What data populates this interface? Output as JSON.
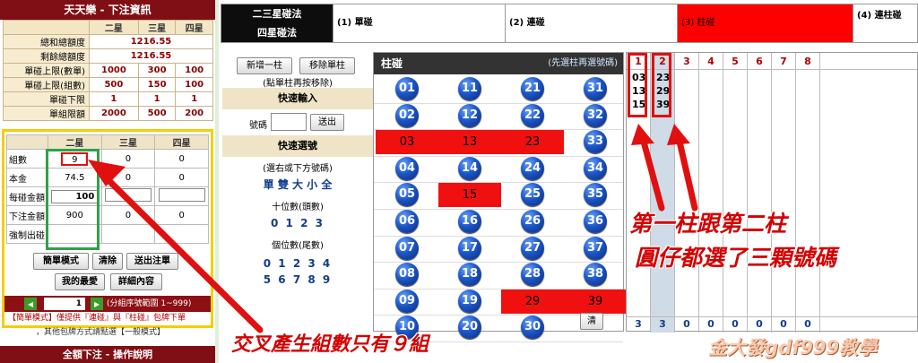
{
  "info": {
    "title": "天天樂 - 下注資訊",
    "cols": [
      "二星",
      "三星",
      "四星"
    ],
    "rows": [
      {
        "label": "總和總額度",
        "values": [
          "",
          "1216.55",
          ""
        ],
        "span": true
      },
      {
        "label": "剩餘總額度",
        "values": [
          "",
          "1216.55",
          ""
        ],
        "span": true
      },
      {
        "label": "單碰上限(數單)",
        "values": [
          "1000",
          "300",
          "100"
        ]
      },
      {
        "label": "單碰上限(組數)",
        "values": [
          "500",
          "150",
          "100"
        ]
      },
      {
        "label": "單碰下限",
        "values": [
          "1",
          "1",
          "1"
        ]
      },
      {
        "label": "單組限額",
        "values": [
          "2000",
          "500",
          "200"
        ]
      }
    ]
  },
  "bet": {
    "cols": [
      "二星",
      "三星",
      "四星"
    ],
    "rows": [
      {
        "label": "組數",
        "values": [
          "9",
          "0",
          "0"
        ]
      },
      {
        "label": "本金",
        "values": [
          "74.5",
          "0",
          "0"
        ]
      },
      {
        "label": "每碰金額",
        "values": [
          "100",
          "",
          ""
        ]
      },
      {
        "label": "下注金額",
        "values": [
          "900",
          "0",
          "0"
        ]
      },
      {
        "label": "強制出碰",
        "values": [
          "",
          "",
          ""
        ]
      }
    ],
    "buttons": {
      "simple": "簡單模式",
      "clear": "清除",
      "submit": "送出注單",
      "favorite": "我的最愛",
      "detail": "詳細內容"
    },
    "page": "1",
    "page_hint": "(分組序號範圍 1~999)",
    "note1": "【簡單模式】僅提供『連碰』與『柱碰』包牌下單",
    "note2": "，其他包牌方式請點選【一般模式】"
  },
  "bottom_left": "全額下注 - 操作說明",
  "tabs": {
    "label1": "二三星碰法",
    "label2": "四星碰法",
    "items": [
      "(1) 單碰",
      "(2) 連碰",
      "(3) 柱碰",
      "(4) 連柱碰"
    ],
    "active_color": "#ff0000"
  },
  "controls": {
    "add_col": "新增一柱",
    "remove_single": "移除單柱",
    "hint": "(點單柱再按移除)",
    "quick_input": "快速輸入",
    "number_label": "號碼",
    "send": "送出",
    "quick_select": "快速選號",
    "select_hint": "(選右或下方號碼)",
    "oddeven": "單 雙 大 小 全",
    "tens_label": "十位數(頭數)",
    "tens": "0 1 2 3",
    "units_label": "個位數(尾數)",
    "units_row1": "0 1 2 3 4",
    "units_row2": "5 6 7 8 9"
  },
  "balls": {
    "title": "柱碰",
    "hint": "(先選柱再選號碼)",
    "clear": "清",
    "cols": [
      [
        "01",
        "02",
        "03",
        "04",
        "05",
        "06",
        "07",
        "08",
        "09",
        "10"
      ],
      [
        "11",
        "12",
        "13",
        "14",
        "15",
        "16",
        "17",
        "18",
        "19",
        "20"
      ],
      [
        "21",
        "22",
        "23",
        "24",
        "25",
        "26",
        "27",
        "28",
        "29",
        "30"
      ],
      [
        "31",
        "32",
        "33",
        "34",
        "35",
        "36",
        "37",
        "38",
        "39"
      ]
    ],
    "selected": [
      "03",
      "13",
      "23",
      "15",
      "29",
      "39"
    ]
  },
  "grid": {
    "headers": [
      "1",
      "2",
      "3",
      "4",
      "5",
      "6",
      "7",
      "8"
    ],
    "col1": [
      "03",
      "13",
      "15"
    ],
    "col2": [
      "23",
      "29",
      "39"
    ],
    "footers": [
      "3",
      "3",
      "0",
      "0",
      "0",
      "0",
      "0",
      "0"
    ]
  },
  "annotations": {
    "right_line1": "第一柱跟第二柱",
    "right_line2": "圓仔都選了三顆號碼",
    "bottom": "交叉產生組數只有９組",
    "watermark": "金大發gdf999教學"
  }
}
